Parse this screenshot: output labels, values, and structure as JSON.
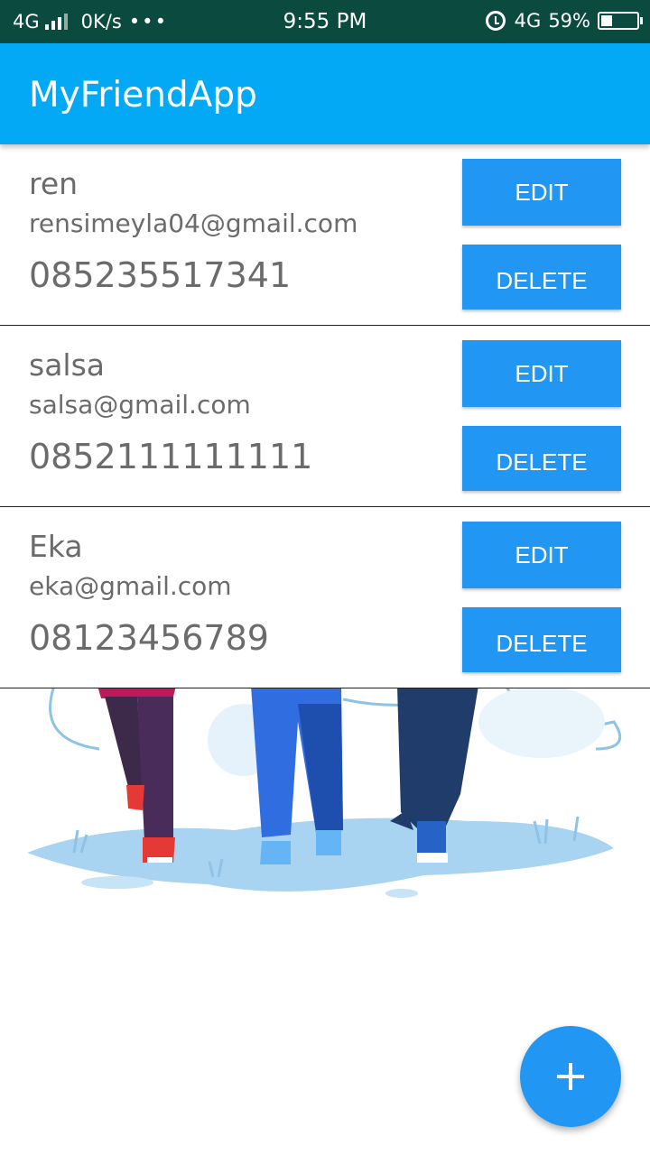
{
  "status_bar": {
    "network": "4G",
    "speed": "0K/s",
    "dots": "•••",
    "time": "9:55 PM",
    "network_right": "4G",
    "battery": "59%"
  },
  "app_bar": {
    "title": "MyFriendApp"
  },
  "friends": [
    {
      "name": "ren",
      "email": "rensimeyla04@gmail.com",
      "phone": "085235517341",
      "edit_label": "EDIT",
      "delete_label": "DELETE"
    },
    {
      "name": "salsa",
      "email": "salsa@gmail.com",
      "phone": "0852111111111",
      "edit_label": "EDIT",
      "delete_label": "DELETE"
    },
    {
      "name": "Eka",
      "email": "eka@gmail.com",
      "phone": "08123456789",
      "edit_label": "EDIT",
      "delete_label": "DELETE"
    }
  ],
  "colors": {
    "status_bar": "#0b4a3e",
    "app_bar": "#03a9f4",
    "button": "#2196f3",
    "text": "#6b6b6b"
  },
  "icons": {
    "fab": "plus-icon",
    "alarm": "alarm-icon",
    "battery": "battery-icon",
    "signal": "signal-icon"
  }
}
